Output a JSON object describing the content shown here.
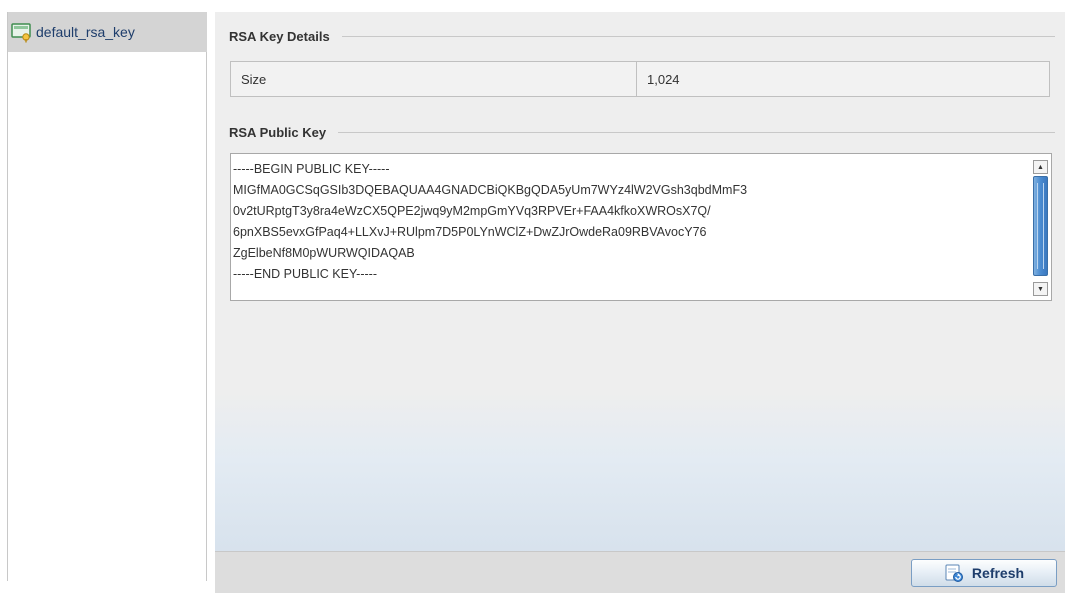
{
  "tree": {
    "item_label": "default_rsa_key",
    "item_icon": "key-icon"
  },
  "details": {
    "title": "RSA Key Details",
    "size_label": "Size",
    "size_value": "1,024"
  },
  "public_key": {
    "title": "RSA Public Key",
    "text": "-----BEGIN PUBLIC KEY-----\nMIGfMA0GCSqGSIb3DQEBAQUAA4GNADCBiQKBgQDA5yUm7WYz4lW2VGsh3qbdMmF3\n0v2tURptgT3y8ra4eWzCX5QPE2jwq9yM2mpGmYVq3RPVEr+FAA4kfkoXWROsX7Q/\n6pnXBS5evxGfPaq4+LLXvJ+RUlpm7D5P0LYnWClZ+DwZJrOwdeRa09RBVAvocY76\nZgElbeNf8M0pWURWQIDAQAB\n-----END PUBLIC KEY-----"
  },
  "footer": {
    "refresh_label": "Refresh",
    "refresh_icon": "refresh-icon"
  },
  "colors": {
    "accent": "#1e3d6b",
    "scroll_thumb": "#4a8bd0",
    "panel_bg": "#eeeeee"
  }
}
